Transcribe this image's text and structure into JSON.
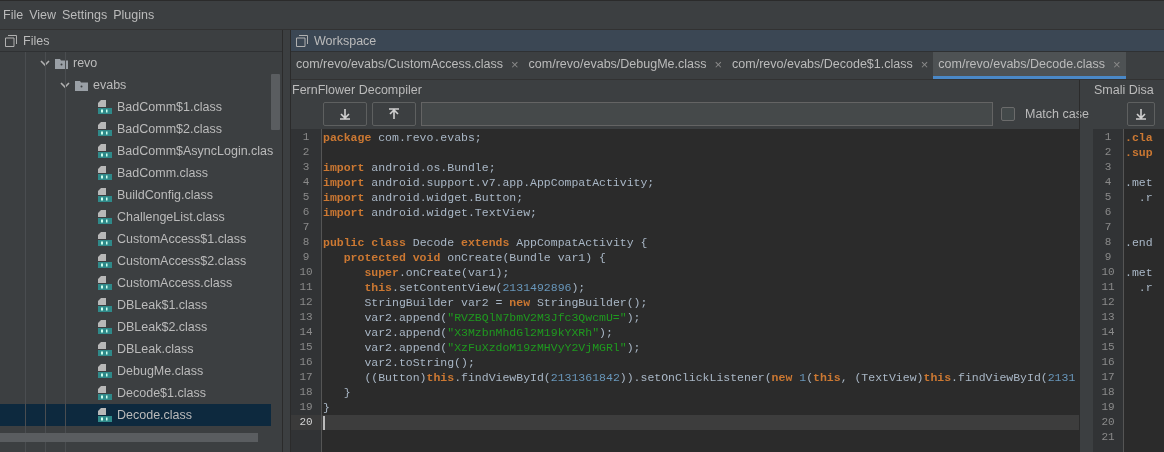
{
  "menu": [
    "File",
    "View",
    "Settings",
    "Plugins"
  ],
  "files_panel": {
    "title": "Files",
    "tree": [
      {
        "label": "revo",
        "kind": "folder",
        "expanded": true,
        "selected": false,
        "children": [
          {
            "label": "evabs",
            "kind": "folder",
            "expanded": true,
            "selected": false,
            "children": [
              {
                "label": "BadComm$1.class",
                "kind": "class",
                "selected": false
              },
              {
                "label": "BadComm$2.class",
                "kind": "class",
                "selected": false
              },
              {
                "label": "BadComm$AsyncLogin.clas",
                "kind": "class",
                "selected": false
              },
              {
                "label": "BadComm.class",
                "kind": "class",
                "selected": false
              },
              {
                "label": "BuildConfig.class",
                "kind": "class",
                "selected": false
              },
              {
                "label": "ChallengeList.class",
                "kind": "class",
                "selected": false
              },
              {
                "label": "CustomAccess$1.class",
                "kind": "class",
                "selected": false
              },
              {
                "label": "CustomAccess$2.class",
                "kind": "class",
                "selected": false
              },
              {
                "label": "CustomAccess.class",
                "kind": "class",
                "selected": false
              },
              {
                "label": "DBLeak$1.class",
                "kind": "class",
                "selected": false
              },
              {
                "label": "DBLeak$2.class",
                "kind": "class",
                "selected": false
              },
              {
                "label": "DBLeak.class",
                "kind": "class",
                "selected": false
              },
              {
                "label": "DebugMe.class",
                "kind": "class",
                "selected": false
              },
              {
                "label": "Decode$1.class",
                "kind": "class",
                "selected": false
              },
              {
                "label": "Decode.class",
                "kind": "class",
                "selected": true
              }
            ]
          }
        ]
      }
    ]
  },
  "workspace": {
    "title": "Workspace",
    "tabs": [
      {
        "label": "com/revo/evabs/CustomAccess.class",
        "close": "×",
        "selected": false
      },
      {
        "label": "com/revo/evabs/DebugMe.class",
        "close": "×",
        "selected": false
      },
      {
        "label": "com/revo/evabs/Decode$1.class",
        "close": "×",
        "selected": false
      },
      {
        "label": "com/revo/evabs/Decode.class",
        "close": "×",
        "selected": true
      }
    ],
    "decompiler": {
      "title": "FernFlower Decompiler",
      "match_case": {
        "label": "Match case",
        "checked": false
      },
      "lines": [
        {
          "number": "1",
          "current": false,
          "tokens": [
            {
              "kind": "kw",
              "text": "package"
            },
            {
              "kind": "plain",
              "text": " com.revo.evabs;"
            }
          ]
        },
        {
          "number": "2",
          "current": false
        },
        {
          "number": "3",
          "current": false,
          "tokens": [
            {
              "kind": "kw",
              "text": "import"
            },
            {
              "kind": "plain",
              "text": " android.os.Bundle;"
            }
          ]
        },
        {
          "number": "4",
          "current": false,
          "tokens": [
            {
              "kind": "kw",
              "text": "import"
            },
            {
              "kind": "plain",
              "text": " android.support.v7.app.AppCompatActivity;"
            }
          ]
        },
        {
          "number": "5",
          "current": false,
          "tokens": [
            {
              "kind": "kw",
              "text": "import"
            },
            {
              "kind": "plain",
              "text": " android.widget.Button;"
            }
          ]
        },
        {
          "number": "6",
          "current": false,
          "tokens": [
            {
              "kind": "kw",
              "text": "import"
            },
            {
              "kind": "plain",
              "text": " android.widget.TextView;"
            }
          ]
        },
        {
          "number": "7",
          "current": false
        },
        {
          "number": "8",
          "current": false,
          "tokens": [
            {
              "kind": "kw",
              "text": "public class"
            },
            {
              "kind": "plain",
              "text": " Decode "
            },
            {
              "kind": "kw",
              "text": "extends"
            },
            {
              "kind": "plain",
              "text": " AppCompatActivity {"
            }
          ]
        },
        {
          "number": "9",
          "current": false,
          "tokens": [
            {
              "kind": "kw",
              "text": "   protected void"
            },
            {
              "kind": "plain",
              "text": " onCreate(Bundle var1) {"
            }
          ]
        },
        {
          "number": "10",
          "current": false,
          "tokens": [
            {
              "kind": "kw",
              "text": "      super"
            },
            {
              "kind": "plain",
              "text": ".onCreate(var1);"
            }
          ]
        },
        {
          "number": "11",
          "current": false,
          "tokens": [
            {
              "kind": "kw",
              "text": "      this"
            },
            {
              "kind": "plain",
              "text": ".setContentView("
            },
            {
              "kind": "num",
              "text": "2131492896"
            },
            {
              "kind": "plain",
              "text": ");"
            }
          ]
        },
        {
          "number": "12",
          "current": false,
          "tokens": [
            {
              "kind": "plain",
              "text": "      StringBuilder var2 = "
            },
            {
              "kind": "kw",
              "text": "new"
            },
            {
              "kind": "plain",
              "text": " StringBuilder();"
            }
          ]
        },
        {
          "number": "13",
          "current": false,
          "tokens": [
            {
              "kind": "plain",
              "text": "      var2.append("
            },
            {
              "kind": "str",
              "text": "\"RVZBQlN7bmV2M3Jfc3QwcmU=\""
            },
            {
              "kind": "plain",
              "text": ");"
            }
          ]
        },
        {
          "number": "14",
          "current": false,
          "tokens": [
            {
              "kind": "plain",
              "text": "      var2.append("
            },
            {
              "kind": "str",
              "text": "\"X3MzbnMhdGl2M19kYXRh\""
            },
            {
              "kind": "plain",
              "text": ");"
            }
          ]
        },
        {
          "number": "15",
          "current": false,
          "tokens": [
            {
              "kind": "plain",
              "text": "      var2.append("
            },
            {
              "kind": "str",
              "text": "\"XzFuXzdoM19zMHVyY2VjMGRl\""
            },
            {
              "kind": "plain",
              "text": ");"
            }
          ]
        },
        {
          "number": "16",
          "current": false,
          "tokens": [
            {
              "kind": "plain",
              "text": "      var2.toString();"
            }
          ]
        },
        {
          "number": "17",
          "current": false,
          "tokens": [
            {
              "kind": "plain",
              "text": "      ((Button)"
            },
            {
              "kind": "kw",
              "text": "this"
            },
            {
              "kind": "plain",
              "text": ".findViewById("
            },
            {
              "kind": "num",
              "text": "2131361842"
            },
            {
              "kind": "plain",
              "text": ")).setOnClickListener("
            },
            {
              "kind": "kw",
              "text": "new"
            },
            {
              "kind": "num",
              "text": " 1"
            },
            {
              "kind": "plain",
              "text": "("
            },
            {
              "kind": "kw",
              "text": "this"
            },
            {
              "kind": "plain",
              "text": ", (TextView)"
            },
            {
              "kind": "kw",
              "text": "this"
            },
            {
              "kind": "plain",
              "text": ".findViewById("
            },
            {
              "kind": "num",
              "text": "2131"
            }
          ]
        },
        {
          "number": "18",
          "current": false,
          "tokens": [
            {
              "kind": "plain",
              "text": "   }"
            }
          ]
        },
        {
          "number": "19",
          "current": false,
          "tokens": [
            {
              "kind": "plain",
              "text": "}"
            }
          ]
        },
        {
          "number": "20",
          "current": true
        }
      ]
    },
    "smali": {
      "title": "Smali Disa",
      "lines": [
        {
          "number": "1",
          "tokens": [
            {
              "kind": "kw",
              "text": ".cla"
            }
          ]
        },
        {
          "number": "2",
          "tokens": [
            {
              "kind": "kw",
              "text": ".sup"
            }
          ]
        },
        {
          "number": "3"
        },
        {
          "number": "4",
          "tokens": [
            {
              "kind": "plain",
              "text": ".met"
            }
          ]
        },
        {
          "number": "5",
          "tokens": [
            {
              "kind": "plain",
              "text": "  .r"
            }
          ]
        },
        {
          "number": "6"
        },
        {
          "number": "7"
        },
        {
          "number": "8",
          "tokens": [
            {
              "kind": "plain",
              "text": ".end"
            }
          ]
        },
        {
          "number": "9"
        },
        {
          "number": "10",
          "tokens": [
            {
              "kind": "plain",
              "text": ".met"
            }
          ]
        },
        {
          "number": "11",
          "tokens": [
            {
              "kind": "plain",
              "text": "  .r"
            }
          ]
        },
        {
          "number": "12"
        },
        {
          "number": "13"
        },
        {
          "number": "14"
        },
        {
          "number": "15"
        },
        {
          "number": "16"
        },
        {
          "number": "17"
        },
        {
          "number": "18"
        },
        {
          "number": "19"
        },
        {
          "number": "20"
        },
        {
          "number": "21"
        }
      ]
    }
  }
}
